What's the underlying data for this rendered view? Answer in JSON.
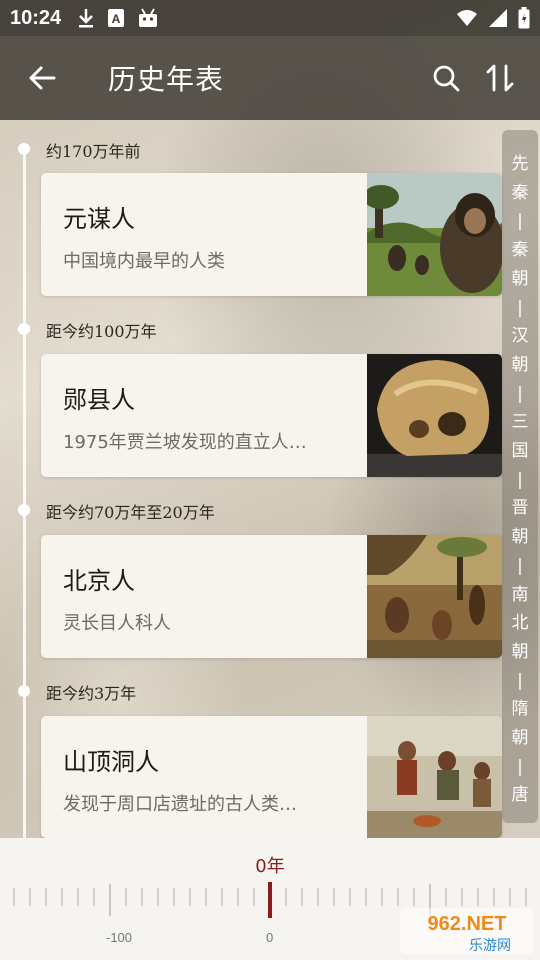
{
  "status": {
    "time": "10:24",
    "icons_left": [
      "download-icon",
      "a-badge-icon",
      "android-icon"
    ],
    "icons_right": [
      "wifi-icon",
      "signal-icon",
      "battery-icon"
    ]
  },
  "appbar": {
    "title": "历史年表",
    "back_icon": "arrow-left-icon",
    "search_icon": "search-icon",
    "sort_icon": "sort-icon"
  },
  "timeline": {
    "entries": [
      {
        "era": "约170万年前",
        "title": "元谋人",
        "desc": "中国境内最早的人类"
      },
      {
        "era": "距今约100万年",
        "title": "郧县人",
        "desc": "1975年贾兰坡发现的直立人…"
      },
      {
        "era": "距今约70万年至20万年",
        "title": "北京人",
        "desc": "灵长目人科人"
      },
      {
        "era": "距今约3万年",
        "title": "山顶洞人",
        "desc": "发现于周口店遗址的古人类…"
      }
    ]
  },
  "side_index": {
    "chars": [
      "先",
      "秦",
      "|",
      "秦",
      "朝",
      "|",
      "汉",
      "朝",
      "|",
      "三",
      "国",
      "|",
      "晋",
      "朝",
      "|",
      "南",
      "北",
      "朝",
      "|",
      "隋",
      "朝",
      "|",
      "唐"
    ]
  },
  "ruler": {
    "current_value": "0年",
    "labels": [
      "-100",
      "0"
    ]
  },
  "watermark": {
    "text_top": "962.NET",
    "text_bottom": "乐游网"
  },
  "colors": {
    "accent": "#8b1c1c",
    "card_bg": "#f7f4ee",
    "appbar_bg": "#46413a"
  }
}
